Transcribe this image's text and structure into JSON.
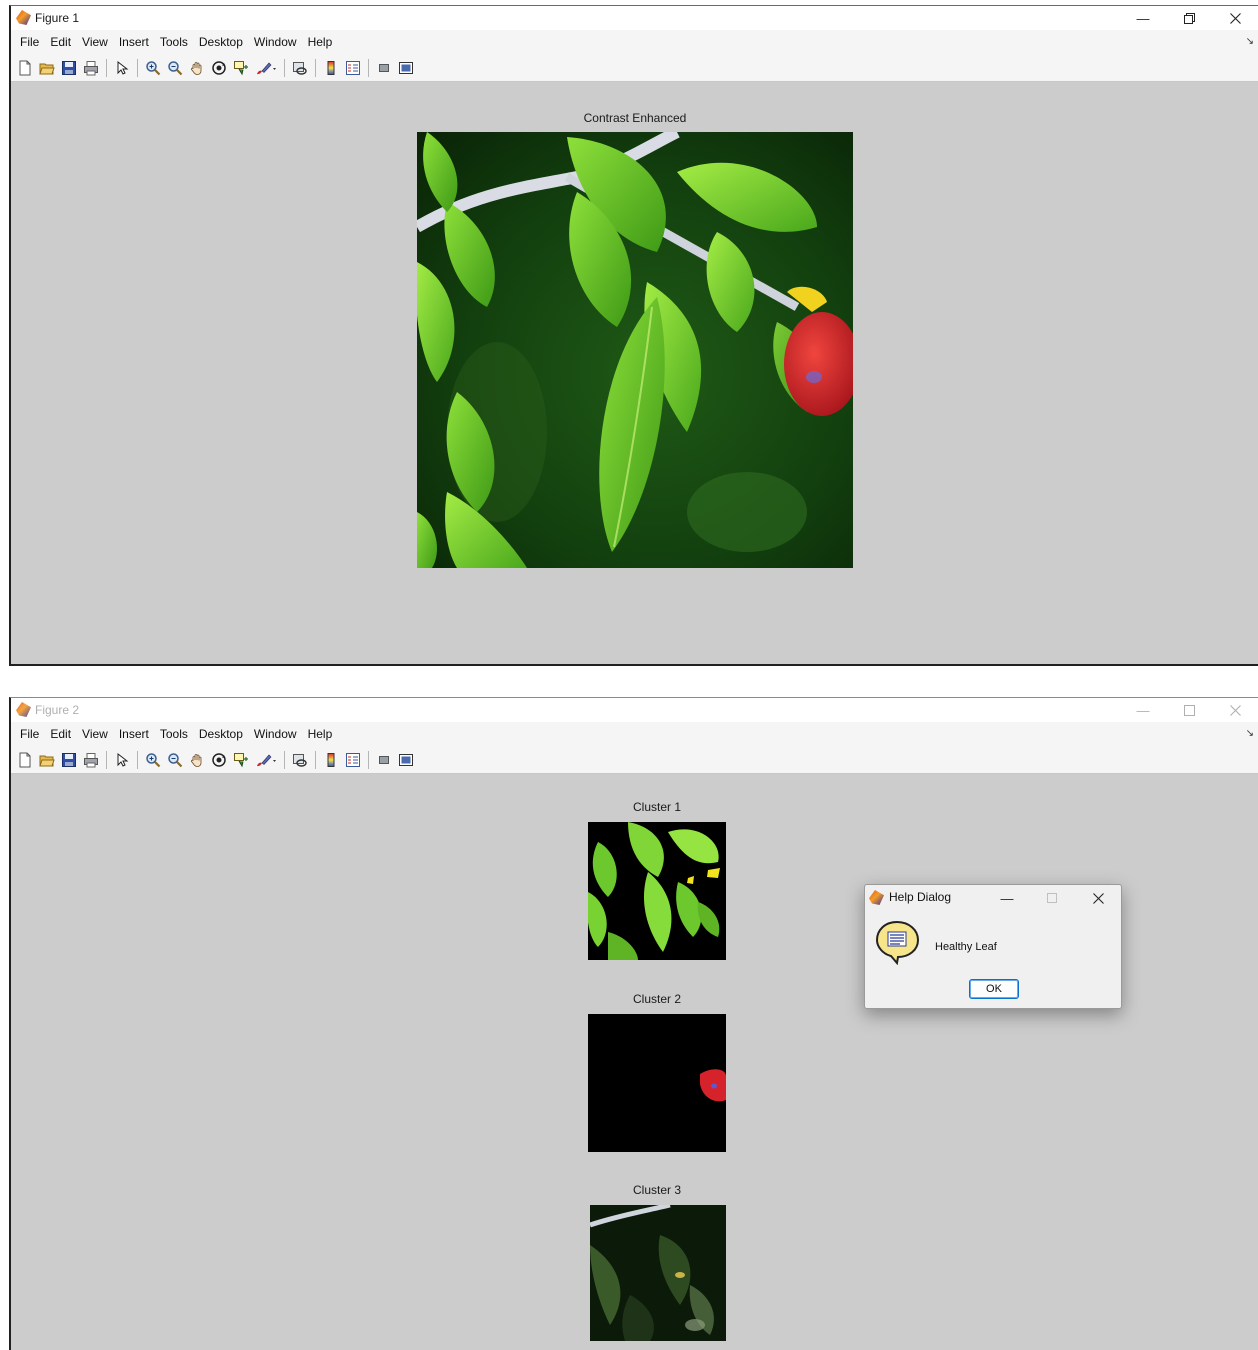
{
  "menu": [
    "File",
    "Edit",
    "View",
    "Insert",
    "Tools",
    "Desktop",
    "Window",
    "Help"
  ],
  "figure1": {
    "title": "Figure 1",
    "axes_title": "Contrast Enhanced"
  },
  "figure2": {
    "title": "Figure 2",
    "clusters": [
      {
        "title": "Cluster 1"
      },
      {
        "title": "Cluster 2"
      },
      {
        "title": "Cluster 3"
      }
    ]
  },
  "help_dialog": {
    "title": "Help Dialog",
    "message": "Healthy Leaf",
    "ok_label": "OK"
  },
  "toolbar_icons": [
    "new-figure-icon",
    "open-file-icon",
    "save-icon",
    "print-icon",
    "edit-plot-icon",
    "zoom-in-icon",
    "zoom-out-icon",
    "pan-icon",
    "rotate-3d-icon",
    "data-cursor-icon",
    "brush-icon",
    "link-plot-icon",
    "colorbar-icon",
    "legend-icon",
    "hide-plot-tools-icon",
    "show-plot-tools-icon"
  ],
  "colors": {
    "figure_bg": "#cccccc",
    "menubar_bg": "#f5f5f5",
    "dialog_bg": "#f0f0f0",
    "ok_border": "#0b6fcf"
  }
}
